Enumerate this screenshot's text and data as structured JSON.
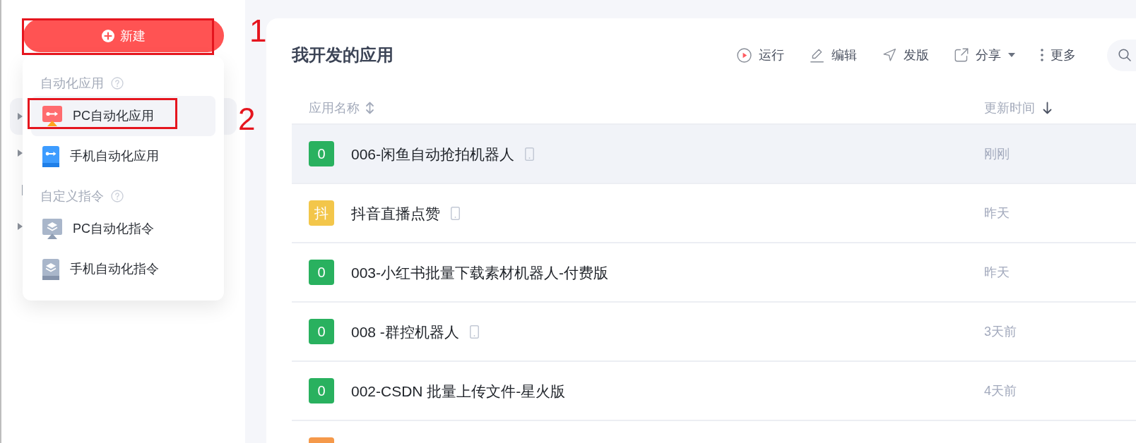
{
  "sidebar": {
    "new_button": {
      "label": "新建",
      "annotation": "1"
    },
    "tree": [
      {
        "kind": "folder",
        "expanded": false,
        "selected": true
      },
      {
        "kind": "folder",
        "expanded": false,
        "selected": false
      },
      {
        "kind": "leaf",
        "selected": false
      },
      {
        "kind": "folder",
        "expanded": false,
        "selected": false
      }
    ]
  },
  "new_menu": {
    "sections": [
      {
        "title": "自动化应用",
        "items": [
          {
            "kind": "pc-app",
            "label": "PC自动化应用",
            "selected": true,
            "annotation": "2"
          },
          {
            "kind": "mobile-app",
            "label": "手机自动化应用",
            "selected": false
          }
        ]
      },
      {
        "title": "自定义指令",
        "items": [
          {
            "kind": "pc-command",
            "label": "PC自动化指令",
            "selected": false
          },
          {
            "kind": "mobile-command",
            "label": "手机自动化指令",
            "selected": false
          }
        ]
      }
    ]
  },
  "main": {
    "title": "我开发的应用",
    "toolbar": [
      {
        "kind": "run",
        "label": "运行"
      },
      {
        "kind": "edit",
        "label": "编辑"
      },
      {
        "kind": "publish",
        "label": "发版"
      },
      {
        "kind": "share",
        "label": "分享",
        "has_menu": true
      },
      {
        "kind": "more",
        "label": "更多"
      }
    ]
  },
  "table": {
    "columns": [
      {
        "label": "应用名称",
        "sorted": false
      },
      {
        "label": "更新时间",
        "sorted": true
      }
    ],
    "rows": [
      {
        "avatar": "0",
        "color": "#29b15f",
        "name": "006-闲鱼自动抢拍机器人",
        "mobile": true,
        "time": "刚刚",
        "selected": true
      },
      {
        "avatar": "抖",
        "color": "#f3c64a",
        "name": "抖音直播点赞",
        "mobile": true,
        "time": "昨天",
        "selected": false
      },
      {
        "avatar": "0",
        "color": "#29b15f",
        "name": "003-小红书批量下载素材机器人-付费版",
        "mobile": false,
        "time": "昨天",
        "selected": false
      },
      {
        "avatar": "0",
        "color": "#29b15f",
        "name": "008 -群控机器人",
        "mobile": true,
        "time": "3天前",
        "selected": false
      },
      {
        "avatar": "0",
        "color": "#29b15f",
        "name": "002-CSDN 批量上传文件-星火版",
        "mobile": false,
        "time": "4天前",
        "selected": false
      },
      {
        "color": "#f5994a",
        "selected": false
      }
    ]
  }
}
